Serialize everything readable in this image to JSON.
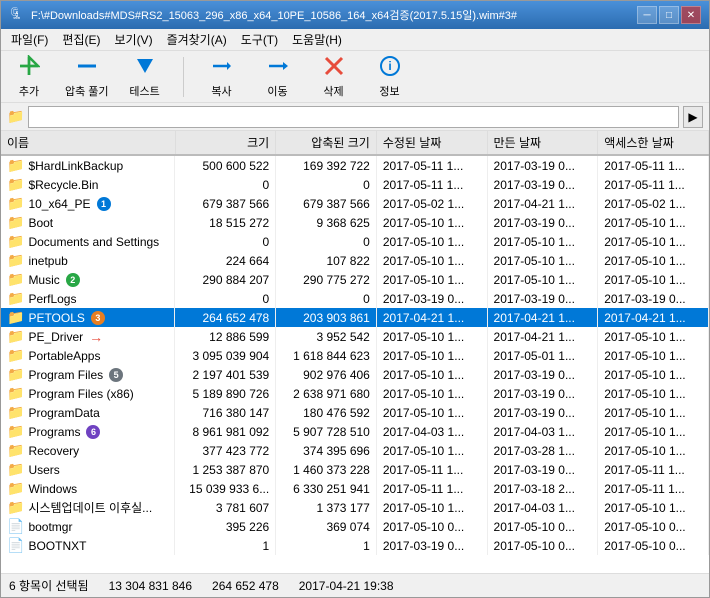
{
  "window": {
    "title": "F:\\#Downloads#MDS#RS2_15063_296_x86_x64_10PE_10586_164_x64검증(2017.5.15일).wim#3#",
    "title_short": "F:#Downloads#MDS#RS2_15063_296_x86_x64_10PE_10586_164_x64검증(2017.5.15일).wim#3#"
  },
  "menu": {
    "items": [
      "파일(F)",
      "편집(E)",
      "보기(V)",
      "즐겨찾기(A)",
      "도구(T)",
      "도움말(H)"
    ]
  },
  "toolbar": {
    "buttons": [
      {
        "label": "추가",
        "icon": "➕",
        "color": "#28a745"
      },
      {
        "label": "압축 풀기",
        "icon": "➖",
        "color": "#0078d7"
      },
      {
        "label": "테스트",
        "icon": "▼",
        "color": "#0078d7"
      },
      {
        "label": "복사",
        "icon": "➡",
        "color": "#0078d7"
      },
      {
        "label": "이동",
        "icon": "➡",
        "color": "#0078d7"
      },
      {
        "label": "삭제",
        "icon": "✖",
        "color": "#e74c3c"
      },
      {
        "label": "정보",
        "icon": "ℹ",
        "color": "#0078d7"
      }
    ]
  },
  "address": {
    "path": "F:#Downloads#MDS#RS2_15063_296_x86_x64_10PE_10586_164_x64검증(2017.5.15일).wim#3#"
  },
  "columns": {
    "name": "이름",
    "size": "크기",
    "compressed": "압축된 크기",
    "modified": "수정된 날짜",
    "created": "만든 날짜",
    "accessed": "액세스한 날짜"
  },
  "files": [
    {
      "name": "$HardLinkBackup",
      "size": "500 600 522",
      "compressed": "169 392 722",
      "modified": "2017-05-11 1...",
      "created": "2017-03-19 0...",
      "accessed": "2017-05-11 1...",
      "icon": "📁",
      "badge": null,
      "selected": false
    },
    {
      "name": "$Recycle.Bin",
      "size": "0",
      "compressed": "0",
      "modified": "2017-05-11 1...",
      "created": "2017-03-19 0...",
      "accessed": "2017-05-11 1...",
      "icon": "📁",
      "badge": null,
      "selected": false
    },
    {
      "name": "10_x64_PE",
      "size": "679 387 566",
      "compressed": "679 387 566",
      "modified": "2017-05-02 1...",
      "created": "2017-04-21 1...",
      "accessed": "2017-05-02 1...",
      "icon": "📁",
      "badge": "1",
      "badge_color": "blue",
      "selected": false
    },
    {
      "name": "Boot",
      "size": "18 515 272",
      "compressed": "9 368 625",
      "modified": "2017-05-10 1...",
      "created": "2017-03-19 0...",
      "accessed": "2017-05-10 1...",
      "icon": "📁",
      "badge": null,
      "selected": false
    },
    {
      "name": "Documents and Settings",
      "size": "0",
      "compressed": "0",
      "modified": "2017-05-10 1...",
      "created": "2017-05-10 1...",
      "accessed": "2017-05-10 1...",
      "icon": "📁",
      "badge": null,
      "selected": false
    },
    {
      "name": "inetpub",
      "size": "224 664",
      "compressed": "107 822",
      "modified": "2017-05-10 1...",
      "created": "2017-05-10 1...",
      "accessed": "2017-05-10 1...",
      "icon": "📁",
      "badge": null,
      "selected": false
    },
    {
      "name": "Music",
      "size": "290 884 207",
      "compressed": "290 775 272",
      "modified": "2017-05-10 1...",
      "created": "2017-05-10 1...",
      "accessed": "2017-05-10 1...",
      "icon": "📁",
      "badge": "2",
      "badge_color": "green",
      "selected": false
    },
    {
      "name": "PerfLogs",
      "size": "0",
      "compressed": "0",
      "modified": "2017-03-19 0...",
      "created": "2017-03-19 0...",
      "accessed": "2017-03-19 0...",
      "icon": "📁",
      "badge": null,
      "selected": false
    },
    {
      "name": "PETOOLS",
      "size": "264 652 478",
      "compressed": "203 903 861",
      "modified": "2017-04-21 1...",
      "created": "2017-04-21 1...",
      "accessed": "2017-04-21 1...",
      "icon": "📁",
      "badge": "3",
      "badge_color": "orange",
      "selected": true
    },
    {
      "name": "PE_Driver",
      "size": "12 886 599",
      "compressed": "3 952 542",
      "modified": "2017-05-10 1...",
      "created": "2017-04-21 1...",
      "accessed": "2017-05-10 1...",
      "icon": "📁",
      "badge": "arrow",
      "badge_color": "red",
      "selected": false
    },
    {
      "name": "PortableApps",
      "size": "3 095 039 904",
      "compressed": "1 618 844 623",
      "modified": "2017-05-10 1...",
      "created": "2017-05-01 1...",
      "accessed": "2017-05-10 1...",
      "icon": "📁",
      "badge": null,
      "selected": false
    },
    {
      "name": "Program Files",
      "size": "2 197 401 539",
      "compressed": "902 976 406",
      "modified": "2017-05-10 1...",
      "created": "2017-03-19 0...",
      "accessed": "2017-05-10 1...",
      "icon": "📁",
      "badge": "5",
      "badge_color": "gray",
      "selected": false
    },
    {
      "name": "Program Files (x86)",
      "size": "5 189 890 726",
      "compressed": "2 638 971 680",
      "modified": "2017-05-10 1...",
      "created": "2017-03-19 0...",
      "accessed": "2017-05-10 1...",
      "icon": "📁",
      "badge": null,
      "selected": false
    },
    {
      "name": "ProgramData",
      "size": "716 380 147",
      "compressed": "180 476 592",
      "modified": "2017-05-10 1...",
      "created": "2017-03-19 0...",
      "accessed": "2017-05-10 1...",
      "icon": "📁",
      "badge": null,
      "selected": false
    },
    {
      "name": "Programs",
      "size": "8 961 981 092",
      "compressed": "5 907 728 510",
      "modified": "2017-04-03 1...",
      "created": "2017-04-03 1...",
      "accessed": "2017-05-10 1...",
      "icon": "📁",
      "badge": "6",
      "badge_color": "purple",
      "selected": false
    },
    {
      "name": "Recovery",
      "size": "377 423 772",
      "compressed": "374 395 696",
      "modified": "2017-05-10 1...",
      "created": "2017-03-28 1...",
      "accessed": "2017-05-10 1...",
      "icon": "📁",
      "badge": null,
      "selected": false
    },
    {
      "name": "Users",
      "size": "1 253 387 870",
      "compressed": "1 460 373 228",
      "modified": "2017-05-11 1...",
      "created": "2017-03-19 0...",
      "accessed": "2017-05-11 1...",
      "icon": "📁",
      "badge": null,
      "selected": false
    },
    {
      "name": "Windows",
      "size": "15 039 933 6...",
      "compressed": "6 330 251 941",
      "modified": "2017-05-11 1...",
      "created": "2017-03-18 2...",
      "accessed": "2017-05-11 1...",
      "icon": "📁",
      "badge": null,
      "selected": false
    },
    {
      "name": "시스템업데이트 이후실...",
      "size": "3 781 607",
      "compressed": "1 373 177",
      "modified": "2017-05-10 1...",
      "created": "2017-04-03 1...",
      "accessed": "2017-05-10 1...",
      "icon": "📁",
      "badge": null,
      "selected": false
    },
    {
      "name": "bootmgr",
      "size": "395 226",
      "compressed": "369 074",
      "modified": "2017-05-10 0...",
      "created": "2017-05-10 0...",
      "accessed": "2017-05-10 0...",
      "icon": "📄",
      "badge": null,
      "selected": false
    },
    {
      "name": "BOOTNXT",
      "size": "1",
      "compressed": "1",
      "modified": "2017-03-19 0...",
      "created": "2017-05-10 0...",
      "accessed": "2017-05-10 0...",
      "icon": "📄",
      "badge": null,
      "selected": false
    }
  ],
  "status": {
    "selected": "6 항목이 선택됨",
    "size": "13 304 831 846",
    "compressed": "264 652 478",
    "date": "2017-04-21 19:38"
  }
}
